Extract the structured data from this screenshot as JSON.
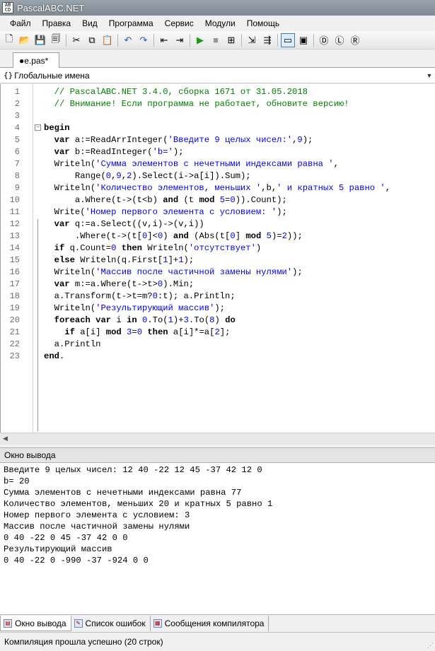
{
  "window": {
    "title": "PascalABC.NET",
    "icon_text": "AB\nCD"
  },
  "menu": {
    "items": [
      "Файл",
      "Правка",
      "Вид",
      "Программа",
      "Сервис",
      "Модули",
      "Помощь"
    ]
  },
  "toolbar": {
    "icons": [
      "new-file-icon",
      "open-folder-icon",
      "save-icon",
      "save-all-icon",
      "cut-icon",
      "copy-icon",
      "paste-icon",
      "undo-icon",
      "redo-icon",
      "nav-back-icon",
      "nav-forward-icon",
      "run-icon",
      "stop-icon",
      "debug-icon",
      "step-into-icon",
      "step-over-icon",
      "console-output-icon",
      "form-designer-icon",
      "template-icon-1",
      "template-icon-2",
      "template-icon-3"
    ],
    "glyphs": [
      "🗋",
      "📂",
      "💾",
      "🗐",
      "✂",
      "⧉",
      "📋",
      "↶",
      "↷",
      "⇤",
      "⇥",
      "▶",
      "■",
      "⊞",
      "⇲",
      "⇶",
      "▭",
      "▣",
      "Ⓓ",
      "Ⓛ",
      "Ⓡ"
    ]
  },
  "editor_tab": {
    "label": "●e.pas*"
  },
  "scope": {
    "icon": "{}",
    "label": "Глобальные имена"
  },
  "code": {
    "lines": [
      {
        "n": "1",
        "segs": [
          [
            "cm",
            "  // PascalABC.NET 3.4.0, сборка 1671 от 31.05.2018"
          ]
        ]
      },
      {
        "n": "2",
        "segs": [
          [
            "cm",
            "  // Внимание! Если программа не работает, обновите версию!"
          ]
        ]
      },
      {
        "n": "3",
        "segs": []
      },
      {
        "n": "4",
        "fold": "−",
        "segs": [
          [
            "kw",
            "begin"
          ]
        ]
      },
      {
        "n": "5",
        "segs": [
          [
            "kw",
            "  var "
          ],
          [
            "op",
            "a:=ReadArrInteger("
          ],
          [
            "st",
            "'Введите 9 целых чисел:'"
          ],
          [
            "op",
            ","
          ],
          [
            "nm",
            "9"
          ],
          [
            "op",
            ");"
          ]
        ]
      },
      {
        "n": "6",
        "segs": [
          [
            "kw",
            "  var "
          ],
          [
            "op",
            "b:=ReadInteger("
          ],
          [
            "st",
            "'b='"
          ],
          [
            "op",
            ");"
          ]
        ]
      },
      {
        "n": "7",
        "segs": [
          [
            "op",
            "  Writeln("
          ],
          [
            "st",
            "'Сумма элементов с нечетными индексами равна '"
          ],
          [
            "op",
            ","
          ]
        ]
      },
      {
        "n": "8",
        "segs": [
          [
            "op",
            "      Range("
          ],
          [
            "nm",
            "0"
          ],
          [
            "op",
            ","
          ],
          [
            "nm",
            "9"
          ],
          [
            "op",
            ","
          ],
          [
            "nm",
            "2"
          ],
          [
            "op",
            ").Select(i->a[i]).Sum);"
          ]
        ]
      },
      {
        "n": "9",
        "segs": [
          [
            "op",
            "  Writeln("
          ],
          [
            "st",
            "'Количество элементов, меньших '"
          ],
          [
            "op",
            ",b,"
          ],
          [
            "st",
            "' и кратных 5 равно '"
          ],
          [
            "op",
            ","
          ]
        ]
      },
      {
        "n": "10",
        "segs": [
          [
            "op",
            "      a.Where(t->(t<b) "
          ],
          [
            "kw",
            "and"
          ],
          [
            "op",
            " (t "
          ],
          [
            "kw",
            "mod"
          ],
          [
            "op",
            " "
          ],
          [
            "nm",
            "5"
          ],
          [
            "op",
            "="
          ],
          [
            "nm",
            "0"
          ],
          [
            "op",
            ")).Count);"
          ]
        ]
      },
      {
        "n": "11",
        "segs": [
          [
            "op",
            "  Write("
          ],
          [
            "st",
            "'Номер первого элемента с условием: '"
          ],
          [
            "op",
            ");"
          ]
        ]
      },
      {
        "n": "12",
        "segs": [
          [
            "kw",
            "  var "
          ],
          [
            "op",
            "q:=a.Select((v,i)->(v,i))"
          ]
        ]
      },
      {
        "n": "13",
        "segs": [
          [
            "op",
            "      .Where(t->(t["
          ],
          [
            "nm",
            "0"
          ],
          [
            "op",
            "]<"
          ],
          [
            "nm",
            "0"
          ],
          [
            "op",
            ") "
          ],
          [
            "kw",
            "and"
          ],
          [
            "op",
            " (Abs(t["
          ],
          [
            "nm",
            "0"
          ],
          [
            "op",
            "] "
          ],
          [
            "kw",
            "mod"
          ],
          [
            "op",
            " "
          ],
          [
            "nm",
            "5"
          ],
          [
            "op",
            ")="
          ],
          [
            "nm",
            "2"
          ],
          [
            "op",
            "));"
          ]
        ]
      },
      {
        "n": "14",
        "segs": [
          [
            "kw",
            "  if "
          ],
          [
            "op",
            "q.Count="
          ],
          [
            "nm",
            "0"
          ],
          [
            "kw",
            " then "
          ],
          [
            "op",
            "Writeln("
          ],
          [
            "st",
            "'отсутствует'"
          ],
          [
            "op",
            ")"
          ]
        ]
      },
      {
        "n": "15",
        "segs": [
          [
            "kw",
            "  else "
          ],
          [
            "op",
            "Writeln(q.First["
          ],
          [
            "nm",
            "1"
          ],
          [
            "op",
            "]+"
          ],
          [
            "nm",
            "1"
          ],
          [
            "op",
            ");"
          ]
        ]
      },
      {
        "n": "16",
        "segs": [
          [
            "op",
            "  Writeln("
          ],
          [
            "st",
            "'Массив после частичной замены нулями'"
          ],
          [
            "op",
            ");"
          ]
        ]
      },
      {
        "n": "17",
        "segs": [
          [
            "kw",
            "  var "
          ],
          [
            "op",
            "m:=a.Where(t->t>"
          ],
          [
            "nm",
            "0"
          ],
          [
            "op",
            ").Min;"
          ]
        ]
      },
      {
        "n": "18",
        "segs": [
          [
            "op",
            "  a.Transform(t->t=m?"
          ],
          [
            "nm",
            "0"
          ],
          [
            "op",
            ":t); a.Println;"
          ]
        ]
      },
      {
        "n": "19",
        "segs": [
          [
            "op",
            "  Writeln("
          ],
          [
            "st",
            "'Результирующий массив'"
          ],
          [
            "op",
            ");"
          ]
        ]
      },
      {
        "n": "20",
        "segs": [
          [
            "kw",
            "  foreach var "
          ],
          [
            "op",
            "i "
          ],
          [
            "kw",
            "in "
          ],
          [
            "nm",
            "0"
          ],
          [
            "op",
            ".To("
          ],
          [
            "nm",
            "1"
          ],
          [
            "op",
            ")+"
          ],
          [
            "nm",
            "3"
          ],
          [
            "op",
            ".To("
          ],
          [
            "nm",
            "8"
          ],
          [
            "op",
            ")"
          ],
          [
            "kw",
            " do"
          ]
        ]
      },
      {
        "n": "21",
        "segs": [
          [
            "kw",
            "    if "
          ],
          [
            "op",
            "a[i] "
          ],
          [
            "kw",
            "mod "
          ],
          [
            "nm",
            "3"
          ],
          [
            "op",
            "="
          ],
          [
            "nm",
            "0"
          ],
          [
            "kw",
            " then "
          ],
          [
            "op",
            "a[i]*=a["
          ],
          [
            "nm",
            "2"
          ],
          [
            "op",
            "];"
          ]
        ]
      },
      {
        "n": "22",
        "segs": [
          [
            "op",
            "  a.Println"
          ]
        ]
      },
      {
        "n": "23",
        "segs": [
          [
            "kw",
            "end"
          ],
          [
            "op",
            "."
          ]
        ]
      }
    ]
  },
  "output_panel": {
    "title": "Окно вывода",
    "lines": [
      "Введите 9 целых чисел: 12 40 -22 12 45 -37 42 12 0",
      "b= 20",
      "Сумма элементов с нечетными индексами равна 77",
      "Количество элементов, меньших 20 и кратных 5 равно 1",
      "Номер первого элемента с условием: 3",
      "Массив после частичной замены нулями",
      "0 40 -22 0 45 -37 42 0 0",
      "Результирующий массив",
      "0 40 -22 0 -990 -37 -924 0 0"
    ]
  },
  "bottom_tabs": [
    {
      "label": "Окно вывода",
      "selected": true
    },
    {
      "label": "Список ошибок",
      "selected": false
    },
    {
      "label": "Сообщения компилятора",
      "selected": false
    }
  ],
  "status": {
    "text": "Компиляция прошла успешно (20 строк)"
  }
}
